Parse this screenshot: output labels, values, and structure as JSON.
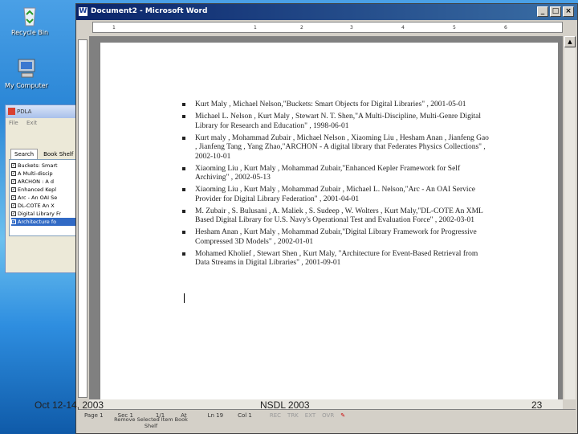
{
  "desktop": {
    "icons": [
      {
        "label": "Recycle Bin",
        "icon": "recycle-bin-icon"
      },
      {
        "label": "My Computer",
        "icon": "my-computer-icon"
      }
    ]
  },
  "pdla": {
    "title": "PDLA",
    "menu": [
      "File",
      "Exit"
    ],
    "tabs": [
      "Search",
      "Book Shelf"
    ],
    "items": [
      "Buckets: Smart",
      "A Multi-discip",
      "ARCHON : A d",
      "Enhanced Kepl",
      "Arc - An OAI Se",
      "DL-COTE An X",
      "Digital Library Fr",
      "Architecture fo"
    ]
  },
  "word": {
    "title": "Document2 - Microsoft Word",
    "ruler_ticks": [
      "1",
      "1",
      "2",
      "3",
      "4",
      "5",
      "6"
    ],
    "references": [
      "Kurt Maly , Michael Nelson,\"Buckets: Smart Objects for Digital Libraries\" , 2001-05-01",
      "Michael L. Nelson , Kurt Maly , Stewart N. T. Shen,\"A Multi-Discipline, Multi-Genre Digital Library for Research and Education\" , 1998-06-01",
      "Kurt maly , Mohammad Zubair , Michael Nelson , Xiaoming Liu , Hesham Anan , Jianfeng Gao , Jianfeng Tang , Yang Zhao,\"ARCHON - A digital library that Federates Physics Collections\" , 2002-10-01",
      "Xiaoming Liu , Kurt Maly , Mohammad Zubair,\"Enhanced Kepler Framework for Self Archiving\" , 2002-05-13",
      "Xiaoming Liu , Kurt Maly , Mohammad Zubair , Michael L. Nelson,\"Arc - An OAI Service Provider for Digital Library Federation\" , 2001-04-01",
      "M. Zubair , S. Bulusani , A. Maliek , S. Sudeep , W. Wolters , Kurt Maly,\"DL-COTE An XML Based Digital Library for U.S. Navy's Operational Test and Evaluation Force\" , 2002-03-01",
      "Hesham Anan , Kurt Maly , Mohammad Zubair,\"Digital Library Framework for Progressive Compressed 3D Models\" , 2002-01-01",
      "Mohamed Kholief , Stewart Shen , Kurt Maly, \"Architecture for Event-Based Retrieval from Data Streams in Digital Libraries\" , 2001-09-01"
    ],
    "status": {
      "page": "Page 1",
      "sec": "Sec 1",
      "pages": "1/1",
      "at": "At",
      "ln": "Ln 19",
      "col": "Col 1",
      "rec": "REC",
      "trk": "TRK",
      "ext": "EXT",
      "ovr": "OVR"
    }
  },
  "taskbar_button": "Remove Selected Item Book Shelf",
  "footer": {
    "date": "Oct 12-14, 2003",
    "conference": "NSDL 2003",
    "page_number": "23"
  }
}
